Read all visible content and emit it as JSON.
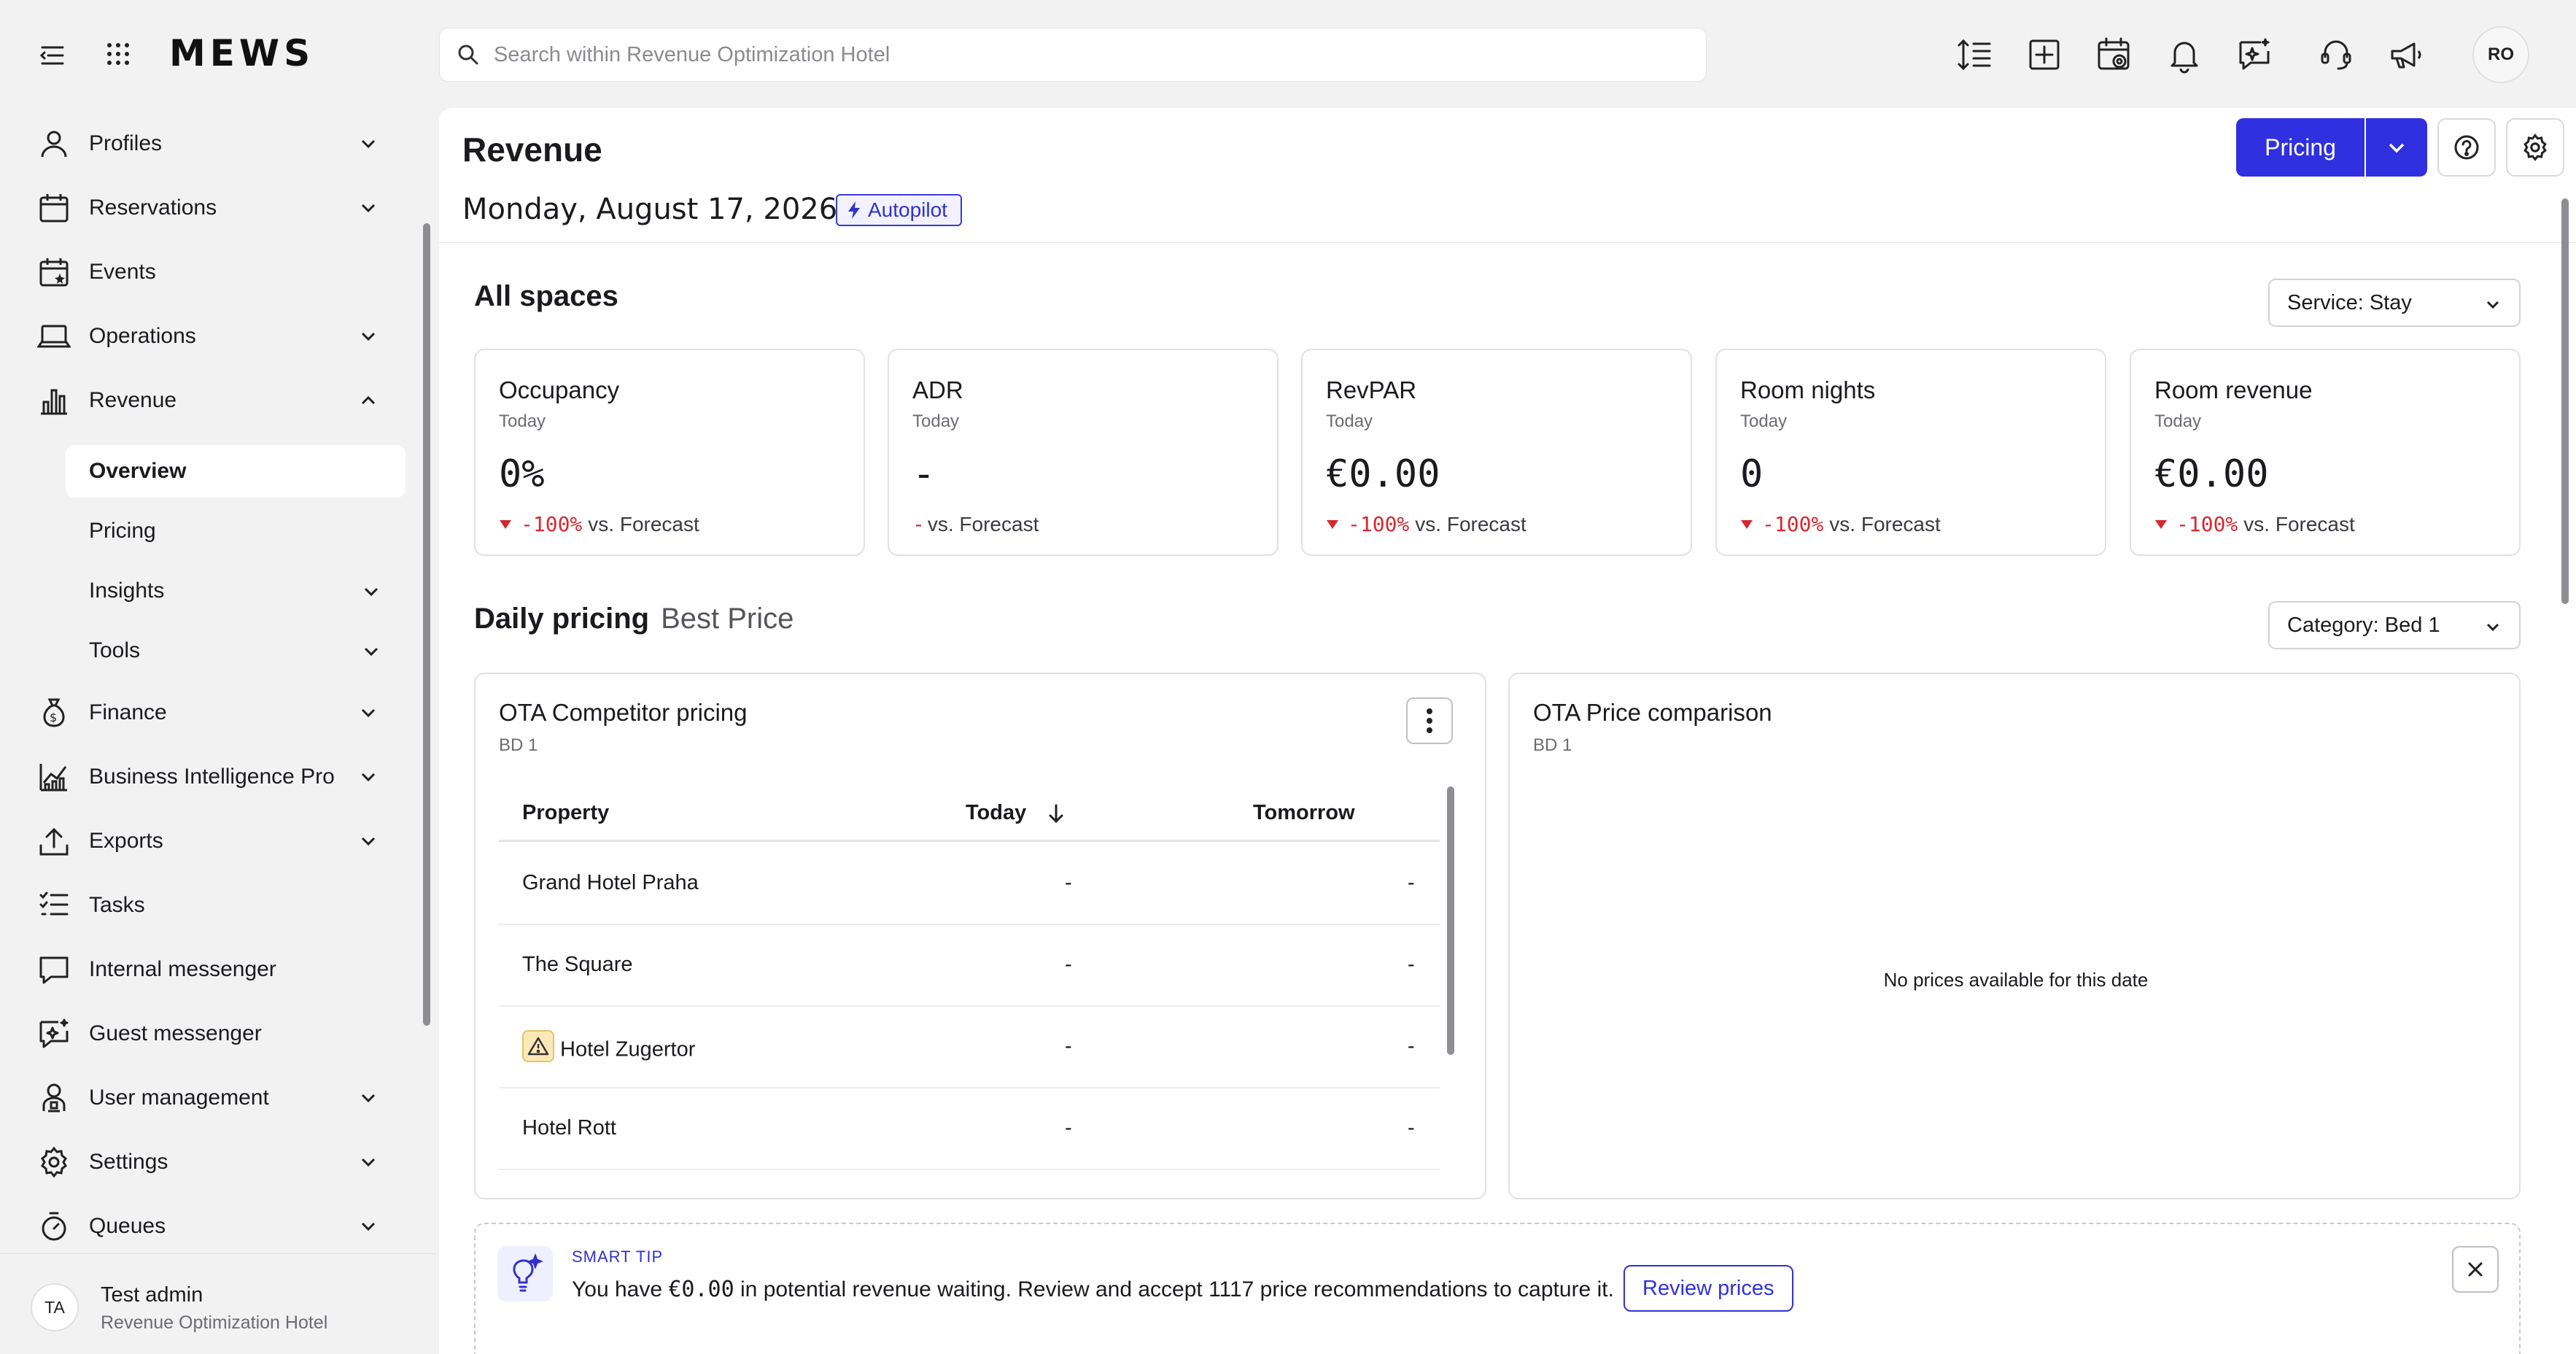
{
  "app": {
    "logo": "MEWS",
    "avatar_initials": "RO"
  },
  "search": {
    "placeholder": "Search within Revenue Optimization Hotel"
  },
  "toolbar_icons": [
    "line-height-icon",
    "add-square-icon",
    "calendar-view-icon",
    "bell-icon",
    "ai-chat-icon",
    "support-icon",
    "announce-icon"
  ],
  "sidebar": {
    "items": [
      {
        "label": "Profiles",
        "icon": "user-icon",
        "expandable": true
      },
      {
        "label": "Reservations",
        "icon": "calendar-icon",
        "expandable": true
      },
      {
        "label": "Events",
        "icon": "calendar-star-icon",
        "expandable": false
      },
      {
        "label": "Operations",
        "icon": "laptop-icon",
        "expandable": true
      },
      {
        "label": "Revenue",
        "icon": "bar-chart-icon",
        "expandable": true,
        "expanded": true
      },
      {
        "label": "Finance",
        "icon": "money-bag-icon",
        "expandable": true
      },
      {
        "label": "Business Intelligence Pro",
        "icon": "trend-chart-icon",
        "expandable": true
      },
      {
        "label": "Exports",
        "icon": "upload-icon",
        "expandable": true
      },
      {
        "label": "Tasks",
        "icon": "checklist-icon",
        "expandable": false
      },
      {
        "label": "Internal messenger",
        "icon": "chat-icon",
        "expandable": false
      },
      {
        "label": "Guest messenger",
        "icon": "chat-sparkle-icon",
        "expandable": false
      },
      {
        "label": "User management",
        "icon": "user-badge-icon",
        "expandable": true
      },
      {
        "label": "Settings",
        "icon": "gear-icon",
        "expandable": true
      },
      {
        "label": "Queues",
        "icon": "stopwatch-icon",
        "expandable": true
      }
    ],
    "revenue_sub": [
      {
        "label": "Overview",
        "active": true
      },
      {
        "label": "Pricing"
      },
      {
        "label": "Insights",
        "expandable": true
      },
      {
        "label": "Tools",
        "expandable": true
      }
    ],
    "user": {
      "initials": "TA",
      "name": "Test admin",
      "hotel": "Revenue Optimization Hotel"
    }
  },
  "header": {
    "title": "Revenue",
    "date": "Monday, August 17, 2026",
    "autopilot": "Autopilot",
    "pricing_button": "Pricing"
  },
  "all_spaces": {
    "title": "All spaces",
    "service_select": "Service: Stay",
    "kpis": [
      {
        "title": "Occupancy",
        "period": "Today",
        "value": "0%",
        "change": "-100%",
        "suffix": "vs. Forecast"
      },
      {
        "title": "ADR",
        "period": "Today",
        "value": "-",
        "change": "-",
        "suffix": "vs. Forecast"
      },
      {
        "title": "RevPAR",
        "period": "Today",
        "value": "€0.00",
        "change": "-100%",
        "suffix": "vs. Forecast"
      },
      {
        "title": "Room nights",
        "period": "Today",
        "value": "0",
        "change": "-100%",
        "suffix": "vs. Forecast"
      },
      {
        "title": "Room revenue",
        "period": "Today",
        "value": "€0.00",
        "change": "-100%",
        "suffix": "vs. Forecast"
      }
    ]
  },
  "daily_pricing": {
    "title": "Daily pricing",
    "subtitle": "Best Price",
    "category_select": "Category: Bed 1",
    "competitor": {
      "title": "OTA Competitor pricing",
      "sub": "BD 1",
      "columns": [
        "Property",
        "Today",
        "Tomorrow"
      ],
      "rows": [
        {
          "property": "Grand Hotel Praha",
          "today": "-",
          "tomorrow": "-",
          "warning": false
        },
        {
          "property": "The Square",
          "today": "-",
          "tomorrow": "-",
          "warning": false
        },
        {
          "property": "Hotel Zugertor",
          "today": "-",
          "tomorrow": "-",
          "warning": true
        },
        {
          "property": "Hotel Rott",
          "today": "-",
          "tomorrow": "-",
          "warning": false
        }
      ]
    },
    "comparison": {
      "title": "OTA Price comparison",
      "sub": "BD 1",
      "empty": "No prices available for this date"
    }
  },
  "smart_tip": {
    "label": "SMART TIP",
    "msg_pre": "You have ",
    "amount": "€0.00",
    "msg_post": " in potential revenue waiting. Review and accept 1117 price recommendations to capture it.",
    "button": "Review prices"
  },
  "colors": {
    "accent": "#3030e0",
    "negative": "#d6282f",
    "sidebar_bg": "#f2f2f3"
  }
}
